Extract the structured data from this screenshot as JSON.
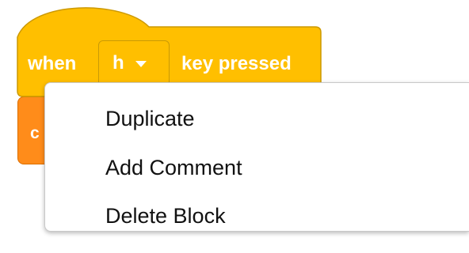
{
  "hat_block": {
    "when_label": "when",
    "key_value": "h",
    "key_pressed_label": "key pressed",
    "dropdown_icon": "chevron-down-icon",
    "color": "#ffbf00",
    "border_color": "#cc9900"
  },
  "underlying_block": {
    "partial_label": "c",
    "color": "#ff8c1a"
  },
  "context_menu": {
    "items": [
      {
        "label": "Duplicate"
      },
      {
        "label": "Add Comment"
      },
      {
        "label": "Delete Block"
      }
    ]
  }
}
